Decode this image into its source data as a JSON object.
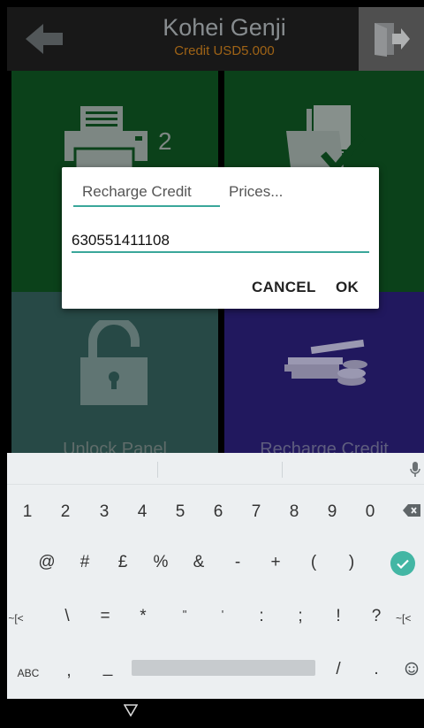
{
  "header": {
    "title": "Kohei Genji",
    "credit": "Credit USD5.000"
  },
  "tiles": {
    "print_badge": "2",
    "unlock_label": "Unlock Panel",
    "recharge_label": "Recharge Credit"
  },
  "dialog": {
    "tab_recharge": "Recharge Credit",
    "tab_prices": "Prices...",
    "input_value": "630551411108",
    "cancel_label": "CANCEL",
    "ok_label": "OK"
  },
  "keyboard": {
    "row1": [
      "1",
      "2",
      "3",
      "4",
      "5",
      "6",
      "7",
      "8",
      "9",
      "0"
    ],
    "row2": [
      "@",
      "#",
      "£",
      "%",
      "&",
      "-",
      "+",
      "(",
      ")"
    ],
    "row3": [
      "~[<",
      "\\",
      "=",
      "*",
      "\"",
      "'",
      ":",
      ";",
      "!",
      "?",
      "~[<"
    ],
    "row4_left": "ABC",
    "row4_comma": ",",
    "row4_underscore": "_",
    "row4_slash": "/",
    "row4_period": "."
  },
  "colors": {
    "accent": "#3aa79a",
    "header_bg": "#1c1c1c",
    "credit": "#b5711a",
    "tile_green": "#0d4a1e",
    "tile_teal": "#2d5450",
    "tile_purple": "#261c6b"
  }
}
